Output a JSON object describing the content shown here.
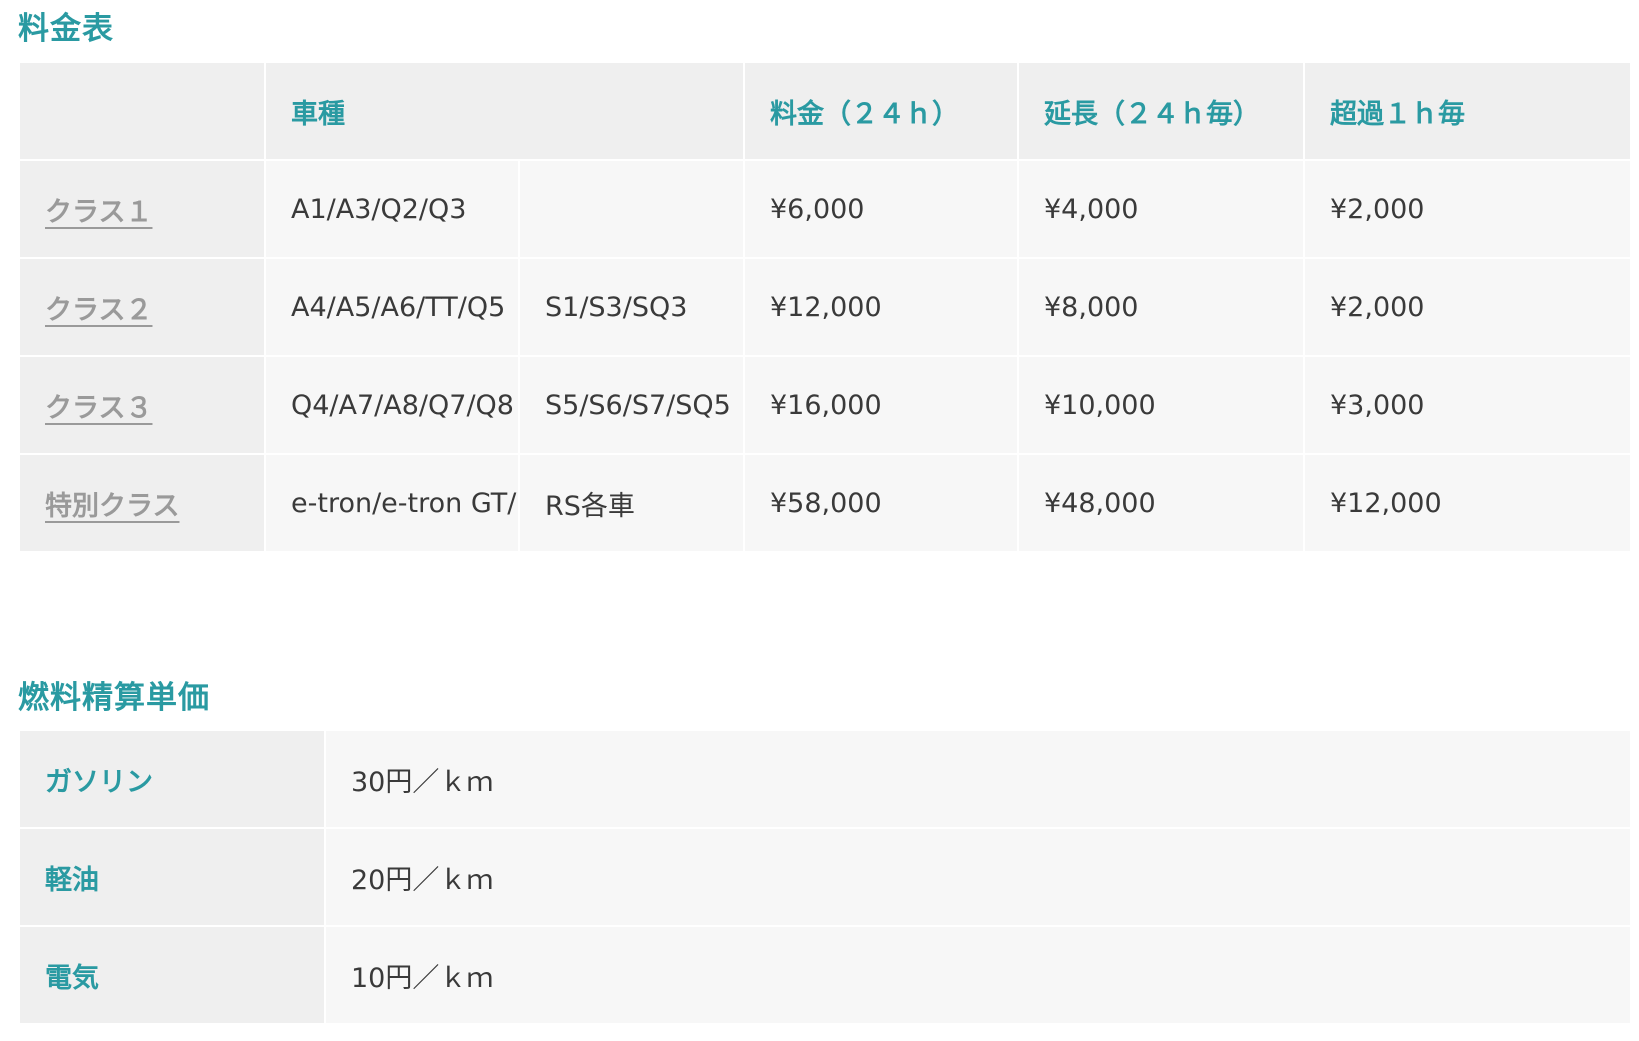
{
  "rates": {
    "title": "料金表",
    "headers": {
      "corner": "",
      "car_type": "車種",
      "fee": "料金（２４ｈ）",
      "extension": "延長（２４ｈ毎）",
      "overtime": "超過１ｈ毎"
    },
    "rows": [
      {
        "class": "クラス１",
        "models_a": "A1/A3/Q2/Q3",
        "models_b": "",
        "fee": "¥6,000",
        "extension": "¥4,000",
        "overtime": "¥2,000"
      },
      {
        "class": "クラス２",
        "models_a": "A4/A5/A6/TT/Q5",
        "models_b": "S1/S3/SQ3",
        "fee": "¥12,000",
        "extension": "¥8,000",
        "overtime": "¥2,000"
      },
      {
        "class": "クラス３",
        "models_a": "Q4/A7/A8/Q7/Q8",
        "models_b": "S5/S6/S7/SQ5",
        "fee": "¥16,000",
        "extension": "¥10,000",
        "overtime": "¥3,000"
      },
      {
        "class": "特別クラス",
        "models_a": "e-tron/e-tron GT/",
        "models_b": "RS各車",
        "fee": "¥58,000",
        "extension": "¥48,000",
        "overtime": "¥12,000"
      }
    ]
  },
  "fuel": {
    "title": "燃料精算単価",
    "rows": [
      {
        "label": "ガソリン",
        "price": "30円／ｋｍ"
      },
      {
        "label": "軽油",
        "price": "20円／ｋｍ"
      },
      {
        "label": "電気",
        "price": "10円／ｋｍ"
      }
    ]
  },
  "colors": {
    "accent": "#2a9aa2",
    "link_gray": "#9a9a9a",
    "header_bg": "#efefef",
    "cell_bg": "#f7f7f7"
  }
}
